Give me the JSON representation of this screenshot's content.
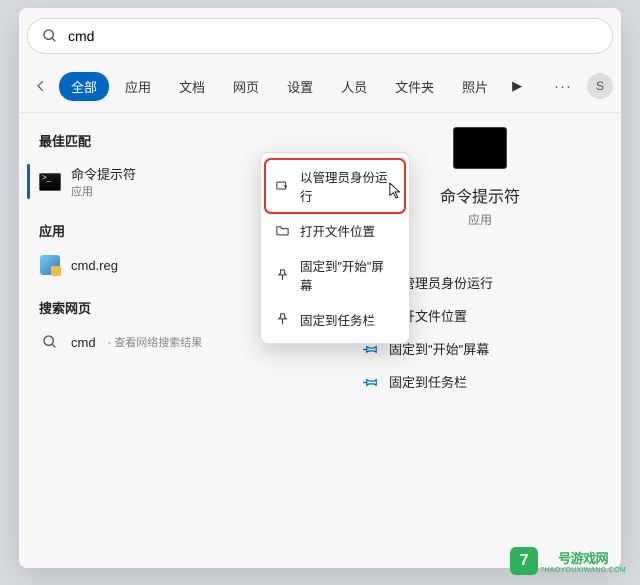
{
  "search": {
    "value": "cmd"
  },
  "tabs": [
    "全部",
    "应用",
    "文档",
    "网页",
    "设置",
    "人员",
    "文件夹",
    "照片"
  ],
  "tab_more_glyph": "▶",
  "avatar_letter": "S",
  "left": {
    "h_best": "最佳匹配",
    "best": {
      "title": "命令提示符",
      "sub": "应用"
    },
    "h_apps": "应用",
    "app_file": "cmd.reg",
    "h_web": "搜索网页",
    "web_q": "cmd",
    "web_extra": " - 查看网络搜索结果"
  },
  "ctx": {
    "run_admin": "以管理员身份运行",
    "open_loc": "打开文件位置",
    "pin_start": "固定到\"开始\"屏幕",
    "pin_task": "固定到任务栏"
  },
  "right": {
    "title": "命令提示符",
    "sub": "应用",
    "actions": {
      "run_admin": "以管理员身份运行",
      "open_loc": "打开文件位置",
      "pin_start": "固定到\"开始\"屏幕",
      "pin_task": "固定到任务栏"
    }
  },
  "watermark": {
    "badge": "7",
    "text": "号游戏网",
    "url": "7HAOYOUXIWANG.COM"
  }
}
